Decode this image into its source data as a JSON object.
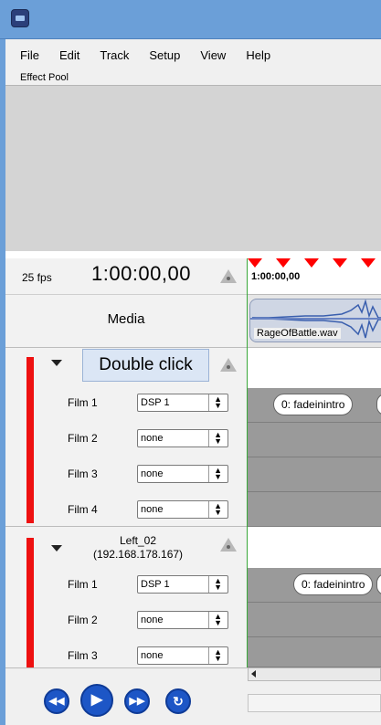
{
  "menu": [
    "File",
    "Edit",
    "Track",
    "Setup",
    "View",
    "Help"
  ],
  "effect_pool": {
    "label": "Effect Pool"
  },
  "transport": {
    "fps": "25 fps",
    "timecode": "1:00:00,00",
    "ruler_timecode": "1:00:00,00"
  },
  "media": {
    "label": "Media",
    "clip_name": "RageOfBattle.wav"
  },
  "tooltip": "Double click",
  "groups": [
    {
      "device": "",
      "tracks": [
        {
          "label": "Film 1",
          "select": "DSP 1",
          "clip": "0: fadeinintro"
        },
        {
          "label": "Film 2",
          "select": "none",
          "clip": ""
        },
        {
          "label": "Film 3",
          "select": "none",
          "clip": ""
        },
        {
          "label": "Film 4",
          "select": "none",
          "clip": ""
        }
      ]
    },
    {
      "device": "Left_02",
      "device_ip": "(192.168.178.167)",
      "tracks": [
        {
          "label": "Film 1",
          "select": "DSP 1",
          "clip": "0: fadeinintro"
        },
        {
          "label": "Film 2",
          "select": "none",
          "clip": ""
        },
        {
          "label": "Film 3",
          "select": "none",
          "clip": ""
        }
      ]
    }
  ],
  "transport_buttons": [
    "skip-back",
    "play",
    "skip-forward",
    "loop"
  ],
  "colors": {
    "title_bar": "#6b9fd8",
    "track_marker": "#ee1111",
    "transport_button": "#1d56c6",
    "timeline_track": "#9a9a9a"
  }
}
